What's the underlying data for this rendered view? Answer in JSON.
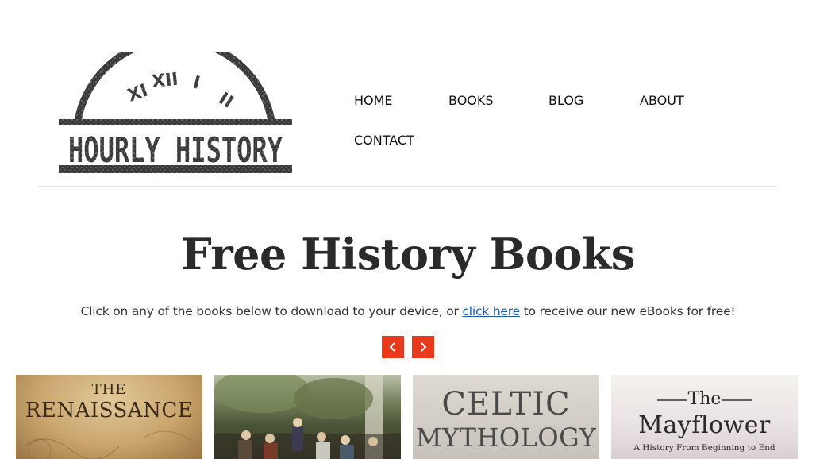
{
  "header": {
    "logo_text": "HOURLY HISTORY",
    "logo_numerals": [
      "XI",
      "XII",
      "I",
      "II"
    ]
  },
  "nav": {
    "items": [
      {
        "label": "HOME"
      },
      {
        "label": "BOOKS"
      },
      {
        "label": "BLOG"
      },
      {
        "label": "ABOUT"
      },
      {
        "label": "CONTACT"
      }
    ]
  },
  "main": {
    "title": "Free History Books",
    "subtitle_before": "Click on any of the books below to download to your device, or ",
    "subtitle_link": "click here",
    "subtitle_after": " to receive our new eBooks for free!",
    "prev_icon": "chevron-left-icon",
    "next_icon": "chevron-right-icon",
    "accent_color": "#e8391d"
  },
  "books": [
    {
      "title_line1": "THE",
      "title_line2": "RENAISSANCE"
    },
    {
      "title_line1": "",
      "title_line2": ""
    },
    {
      "title_line1": "CELTIC",
      "title_line2": "MYTHOLOGY"
    },
    {
      "title_line1": "The",
      "title_line2": "Mayflower",
      "subtitle": "A History From Beginning to End"
    }
  ]
}
